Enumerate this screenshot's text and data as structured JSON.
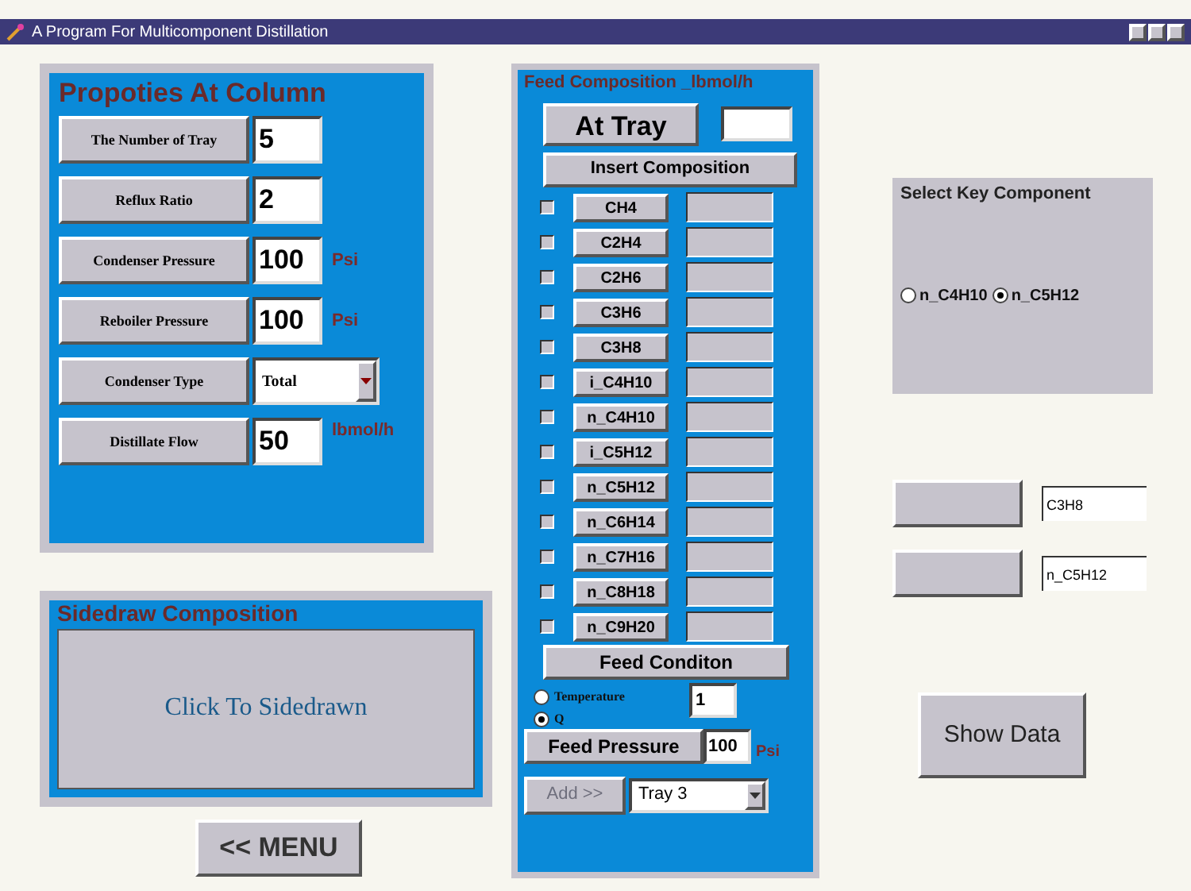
{
  "window": {
    "title": "A Program For Multicomponent Distillation"
  },
  "column_properties": {
    "title": "Propoties At Column",
    "rows": [
      {
        "label": "The Number  of Tray",
        "kind": "text",
        "value": "5"
      },
      {
        "label": "Reflux Ratio",
        "kind": "text",
        "value": "2"
      },
      {
        "label": "Condenser Pressure",
        "kind": "text",
        "value": "100",
        "unit": "Psi"
      },
      {
        "label": "Reboiler Pressure",
        "kind": "text",
        "value": "100",
        "unit": "Psi"
      },
      {
        "label": "Condenser Type",
        "kind": "select",
        "value": "Total"
      },
      {
        "label": "Distillate Flow",
        "kind": "text",
        "value": "50",
        "unit": "lbmol/h"
      }
    ]
  },
  "sidedraw": {
    "title": "Sidedraw  Composition",
    "button": "Click To Sidedrawn"
  },
  "menu_button": "<< MENU",
  "feed": {
    "title": "Feed Composition _lbmol/h",
    "at_tray_button": "At  Tray",
    "insert_button": "Insert Composition",
    "components": [
      {
        "name": "CH4",
        "checked": false
      },
      {
        "name": "C2H4",
        "checked": false
      },
      {
        "name": "C2H6",
        "checked": false
      },
      {
        "name": "C3H6",
        "checked": false
      },
      {
        "name": "C3H8",
        "checked": false
      },
      {
        "name": "i_C4H10",
        "checked": false
      },
      {
        "name": "n_C4H10",
        "checked": false
      },
      {
        "name": "i_C5H12",
        "checked": false
      },
      {
        "name": "n_C5H12",
        "checked": false
      },
      {
        "name": "n_C6H14",
        "checked": false
      },
      {
        "name": "n_C7H16",
        "checked": false
      },
      {
        "name": "n_C8H18",
        "checked": false
      },
      {
        "name": "n_C9H20",
        "checked": false
      }
    ],
    "condition_button": "Feed Conditon",
    "condition_options": [
      {
        "label": "Temperature",
        "selected": false
      },
      {
        "label": "Q",
        "selected": true
      }
    ],
    "condition_value": "1",
    "pressure_button": "Feed Pressure",
    "pressure_value": "100",
    "pressure_unit": "Psi",
    "add_button": {
      "label": "Add >>",
      "disabled": true
    },
    "tray_select": "Tray 3"
  },
  "key_component": {
    "title": "Select Key Component",
    "options": [
      {
        "label": "n_C4H10",
        "selected": false
      },
      {
        "label": "n_C5H12",
        "selected": true
      }
    ]
  },
  "key_fields": [
    {
      "value": "C3H8"
    },
    {
      "value": "n_C5H12"
    }
  ],
  "show_data_button": "Show Data"
}
